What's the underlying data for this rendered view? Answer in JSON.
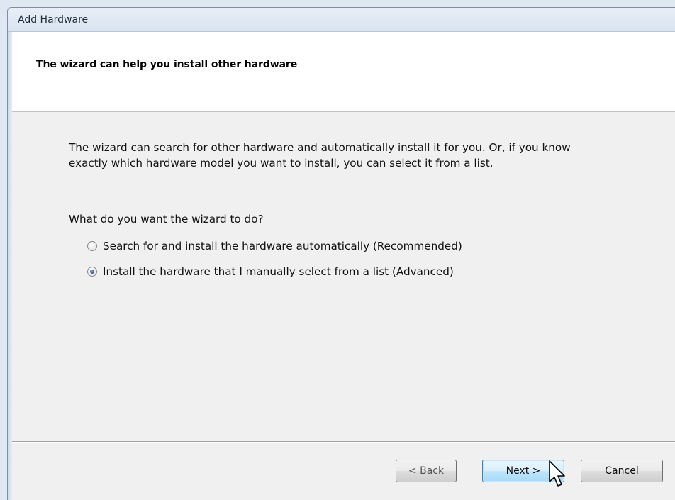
{
  "window": {
    "title": "Add Hardware"
  },
  "header": {
    "heading": "The wizard can help you install other hardware"
  },
  "content": {
    "intro": "The wizard can search for other hardware and automatically install it for you. Or, if you know exactly which hardware model you want to install, you can select it from a list.",
    "question": "What do you want the wizard to do?",
    "options": [
      {
        "label": "Search for and install the hardware automatically (Recommended)",
        "selected": false
      },
      {
        "label": "Install the hardware that I manually select from a list (Advanced)",
        "selected": true
      }
    ]
  },
  "buttons": {
    "back": "< Back",
    "next": "Next >",
    "cancel": "Cancel"
  },
  "icons": {
    "cursor": "mouse-pointer-icon"
  },
  "colors": {
    "header_bg": "#ffffff",
    "body_bg": "#f0f0f0",
    "next_button_highlight": "#bee6fd"
  }
}
